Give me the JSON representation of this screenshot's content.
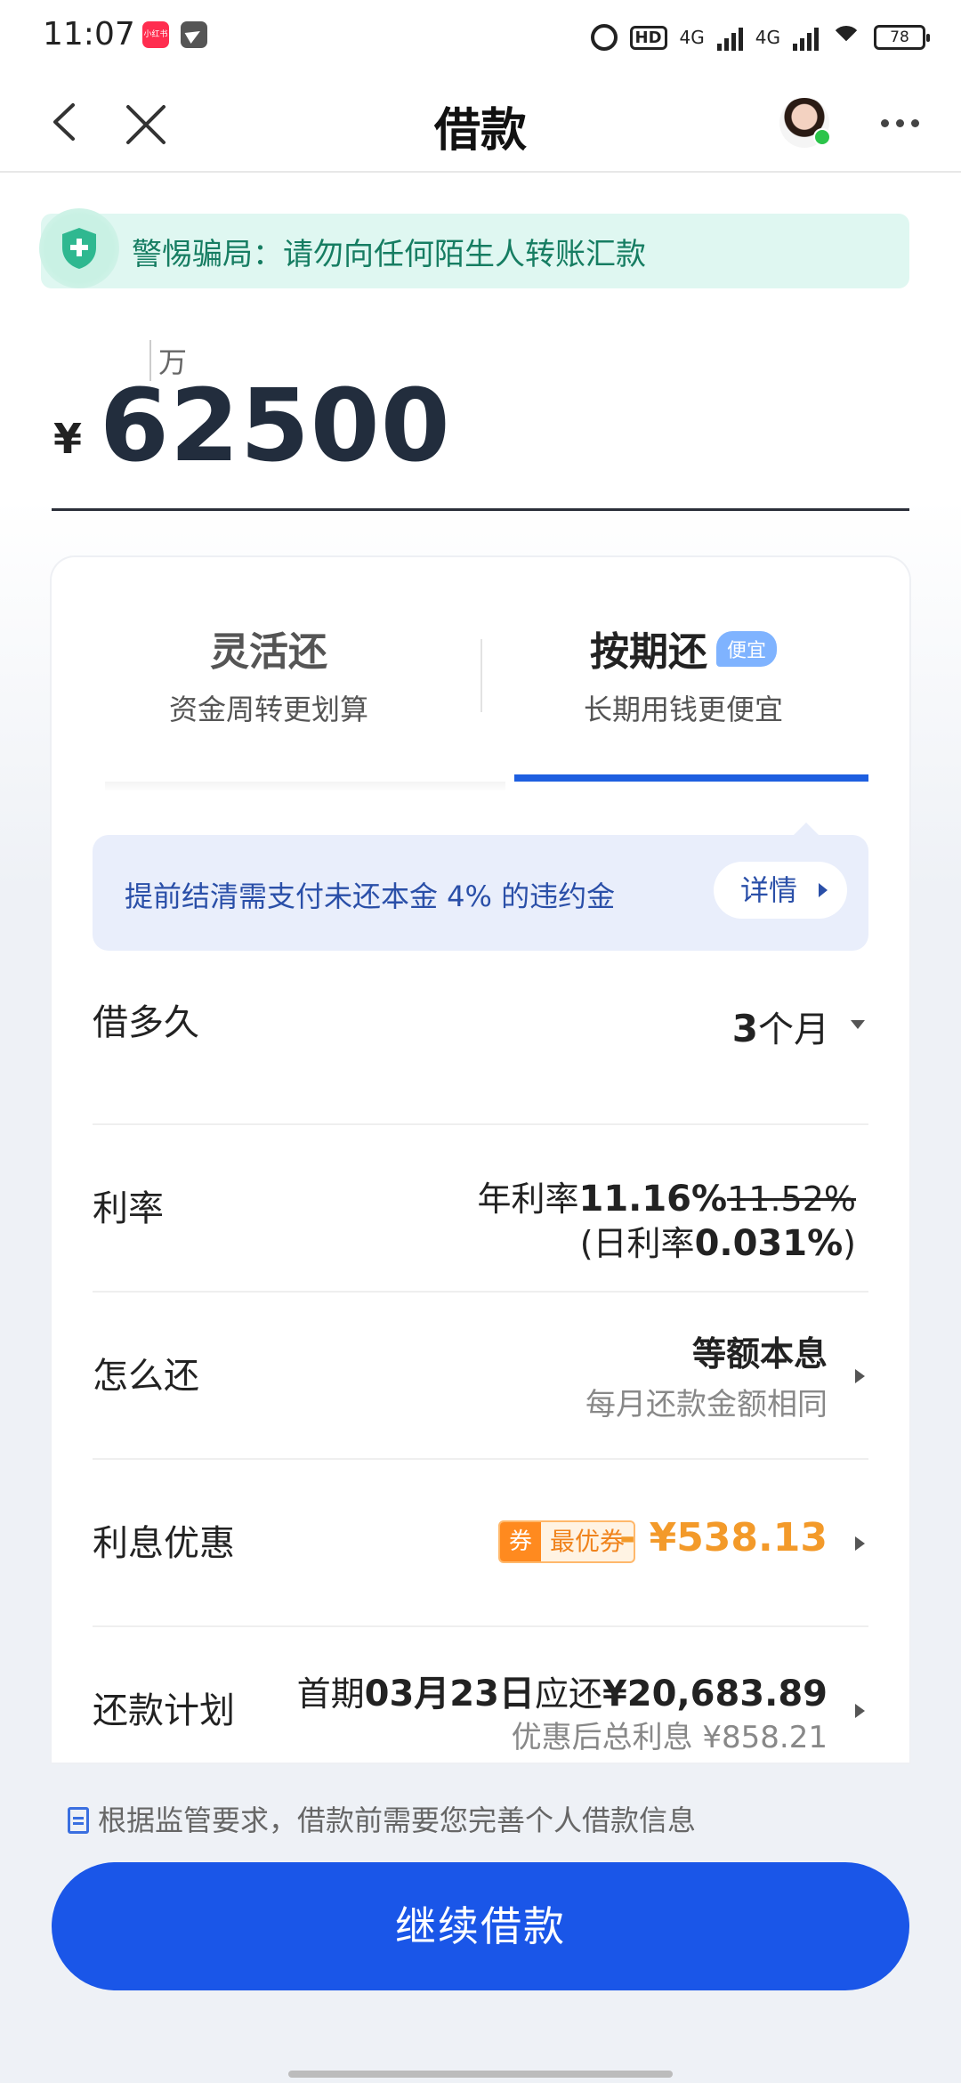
{
  "status_bar": {
    "time": "11:07",
    "app_icon_1": "小红书",
    "network_1": "4G",
    "network_2": "4G",
    "hd": "HD",
    "battery": "78",
    "icons": [
      "alarm-icon",
      "hd-icon",
      "signal-icon",
      "wifi-icon",
      "battery-icon"
    ]
  },
  "nav": {
    "title": "借款",
    "icons": [
      "back-icon",
      "close-icon",
      "avatar",
      "more-icon"
    ]
  },
  "warning": {
    "text": "警惕骗局：请勿向任何陌生人转账汇款",
    "icon": "shield-icon"
  },
  "amount": {
    "unit_hint": "万",
    "currency": "¥",
    "value": "62500"
  },
  "tabs": [
    {
      "title": "灵活还",
      "subtitle": "资金周转更划算",
      "selected": false
    },
    {
      "title": "按期还",
      "subtitle": "长期用钱更便宜",
      "badge": "便宜",
      "selected": true
    }
  ],
  "notice": {
    "text": "提前结清需支付未还本金 4% 的违约金",
    "button": "详情"
  },
  "rows": {
    "term": {
      "label": "借多久",
      "value_num": "3",
      "value_unit": "个月"
    },
    "rate": {
      "label": "利率",
      "annual_prefix": "年利率",
      "annual": "11.16%",
      "annual_original": "11.52%",
      "daily_prefix": "(日利率",
      "daily": "0.031%",
      "daily_suffix": ")"
    },
    "repay_method": {
      "label": "怎么还",
      "value": "等额本息",
      "desc": "每月还款金额相同"
    },
    "discount": {
      "label": "利息优惠",
      "coupon_tag": "券",
      "coupon_text": "最优券",
      "value": "- ¥538.13"
    },
    "plan": {
      "label": "还款计划",
      "line1_prefix": "首期",
      "line1_date": "03月23日",
      "line1_mid": "应还",
      "line1_amount": "¥20,683.89",
      "line2": "优惠后总利息 ¥858.21"
    }
  },
  "footnote": "根据监管要求，借款前需要您完善个人借款信息",
  "cta": "继续借款",
  "colors": {
    "primary": "#1a56e8",
    "warning_bg": "#dff7f1",
    "warning_text": "#167d62",
    "discount": "#f39a2a"
  }
}
